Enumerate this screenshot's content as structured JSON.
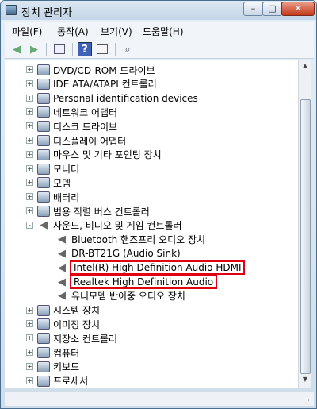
{
  "window": {
    "title": "장치 관리자",
    "minimize": "–",
    "maximize": "□",
    "close": "✕"
  },
  "menu": [
    {
      "label": "파일(F)"
    },
    {
      "label": "동작(A)"
    },
    {
      "label": "보기(V)"
    },
    {
      "label": "도움말(H)"
    }
  ],
  "toolbar": {
    "back": "back-arrow-icon",
    "forward": "forward-arrow-icon",
    "properties": "properties-icon",
    "help": "help-icon",
    "view": "view-icon",
    "scan": "scan-hardware-icon"
  },
  "tree": [
    {
      "label": "DVD/CD-ROM 드라이브",
      "level": 1,
      "expander": "+",
      "icon": "dvd-drive-icon"
    },
    {
      "label": "IDE ATA/ATAPI 컨트롤러",
      "level": 1,
      "expander": "+",
      "icon": "ide-controller-icon"
    },
    {
      "label": "Personal identification devices",
      "level": 1,
      "expander": "+",
      "icon": "fingerprint-device-icon"
    },
    {
      "label": "네트워크 어댑터",
      "level": 1,
      "expander": "+",
      "icon": "network-adapter-icon"
    },
    {
      "label": "디스크 드라이브",
      "level": 1,
      "expander": "+",
      "icon": "disk-drive-icon"
    },
    {
      "label": "디스플레이 어댑터",
      "level": 1,
      "expander": "+",
      "icon": "display-adapter-icon"
    },
    {
      "label": "마우스 및 기타 포인팅 장치",
      "level": 1,
      "expander": "+",
      "icon": "mouse-icon"
    },
    {
      "label": "모니터",
      "level": 1,
      "expander": "+",
      "icon": "monitor-icon"
    },
    {
      "label": "모뎀",
      "level": 1,
      "expander": "+",
      "icon": "modem-icon"
    },
    {
      "label": "배터리",
      "level": 1,
      "expander": "+",
      "icon": "battery-icon"
    },
    {
      "label": "범용 직렬 버스 컨트롤러",
      "level": 1,
      "expander": "+",
      "icon": "usb-controller-icon"
    },
    {
      "label": "사운드, 비디오 및 게임 컨트롤러",
      "level": 1,
      "expander": "-",
      "icon": "speaker-icon"
    },
    {
      "label": "Bluetooth 핸즈프리 오디오 장치",
      "level": 2,
      "expander": "",
      "icon": "speaker-icon"
    },
    {
      "label": "DR-BT21G (Audio Sink)",
      "level": 2,
      "expander": "",
      "icon": "speaker-icon"
    },
    {
      "label": "Intel(R) High Definition Audio HDMI",
      "level": 2,
      "expander": "",
      "icon": "speaker-icon",
      "highlight": true
    },
    {
      "label": "Realtek High Definition Audio",
      "level": 2,
      "expander": "",
      "icon": "speaker-icon",
      "highlight": true
    },
    {
      "label": "유니모뎀 반이중 오디오 장치",
      "level": 2,
      "expander": "",
      "icon": "speaker-icon"
    },
    {
      "label": "시스템 장치",
      "level": 1,
      "expander": "+",
      "icon": "system-device-icon"
    },
    {
      "label": "이미징 장치",
      "level": 1,
      "expander": "+",
      "icon": "imaging-device-icon"
    },
    {
      "label": "저장소 컨트롤러",
      "level": 1,
      "expander": "+",
      "icon": "storage-controller-icon"
    },
    {
      "label": "컴퓨터",
      "level": 1,
      "expander": "+",
      "icon": "computer-icon"
    },
    {
      "label": "키보드",
      "level": 1,
      "expander": "+",
      "icon": "keyboard-icon"
    },
    {
      "label": "프로세서",
      "level": 1,
      "expander": "+",
      "icon": "processor-icon"
    }
  ],
  "colors": {
    "highlight": "#e00012",
    "titlebar": "#c3d5e6",
    "close": "#c3391b"
  }
}
